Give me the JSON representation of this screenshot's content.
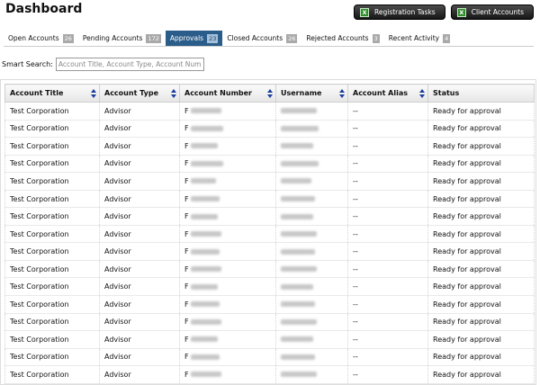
{
  "header": {
    "title": "Dashboard",
    "buttons": [
      {
        "label": "Registration Tasks",
        "icon": "excel-icon"
      },
      {
        "label": "Client Accounts",
        "icon": "excel-icon"
      }
    ]
  },
  "tabs": [
    {
      "label": "Open Accounts",
      "count": "26",
      "active": false
    },
    {
      "label": "Pending Accounts",
      "count": "172",
      "active": false
    },
    {
      "label": "Approvals",
      "count": "23",
      "active": true
    },
    {
      "label": "Closed Accounts",
      "count": "26",
      "active": false
    },
    {
      "label": "Rejected Accounts",
      "count": "3",
      "active": false
    },
    {
      "label": "Recent Activity",
      "count": "4",
      "active": false
    }
  ],
  "search": {
    "label": "Smart Search:",
    "placeholder": "Account Title, Account Type, Account Num",
    "value": ""
  },
  "table": {
    "columns": [
      "Account Title",
      "Account Type",
      "Account Number",
      "Username",
      "Account Alias",
      "Status"
    ],
    "rows": [
      {
        "title": "Test Corporation",
        "type": "Advisor",
        "number_prefix": "F",
        "alias": "--",
        "status": "Ready for approval"
      },
      {
        "title": "Test Corporation",
        "type": "Advisor",
        "number_prefix": "F",
        "alias": "--",
        "status": "Ready for approval"
      },
      {
        "title": "Test Corporation",
        "type": "Advisor",
        "number_prefix": "F",
        "alias": "--",
        "status": "Ready for approval"
      },
      {
        "title": "Test Corporation",
        "type": "Advisor",
        "number_prefix": "F",
        "alias": "--",
        "status": "Ready for approval"
      },
      {
        "title": "Test Corporation",
        "type": "Advisor",
        "number_prefix": "F",
        "alias": "--",
        "status": "Ready for approval"
      },
      {
        "title": "Test Corporation",
        "type": "Advisor",
        "number_prefix": "F",
        "alias": "--",
        "status": "Ready for approval"
      },
      {
        "title": "Test Corporation",
        "type": "Advisor",
        "number_prefix": "F",
        "alias": "--",
        "status": "Ready for approval"
      },
      {
        "title": "Test Corporation",
        "type": "Advisor",
        "number_prefix": "F",
        "alias": "--",
        "status": "Ready for approval"
      },
      {
        "title": "Test Corporation",
        "type": "Advisor",
        "number_prefix": "F",
        "alias": "--",
        "status": "Ready for approval"
      },
      {
        "title": "Test Corporation",
        "type": "Advisor",
        "number_prefix": "F",
        "alias": "--",
        "status": "Ready for approval"
      },
      {
        "title": "Test Corporation",
        "type": "Advisor",
        "number_prefix": "F",
        "alias": "--",
        "status": "Ready for approval"
      },
      {
        "title": "Test Corporation",
        "type": "Advisor",
        "number_prefix": "F",
        "alias": "--",
        "status": "Ready for approval"
      },
      {
        "title": "Test Corporation",
        "type": "Advisor",
        "number_prefix": "F",
        "alias": "--",
        "status": "Ready for approval"
      },
      {
        "title": "Test Corporation",
        "type": "Advisor",
        "number_prefix": "F",
        "alias": "--",
        "status": "Ready for approval"
      },
      {
        "title": "Test Corporation",
        "type": "Advisor",
        "number_prefix": "F",
        "alias": "--",
        "status": "Ready for approval"
      },
      {
        "title": "Test Corporation",
        "type": "Advisor",
        "number_prefix": "F",
        "alias": "--",
        "status": "Ready for approval"
      }
    ]
  },
  "colors": {
    "active_tab": "#2b5d8a",
    "badge": "#a9a9a9",
    "sort_arrow": "#1b3f9a",
    "button_bg": "#161616"
  }
}
